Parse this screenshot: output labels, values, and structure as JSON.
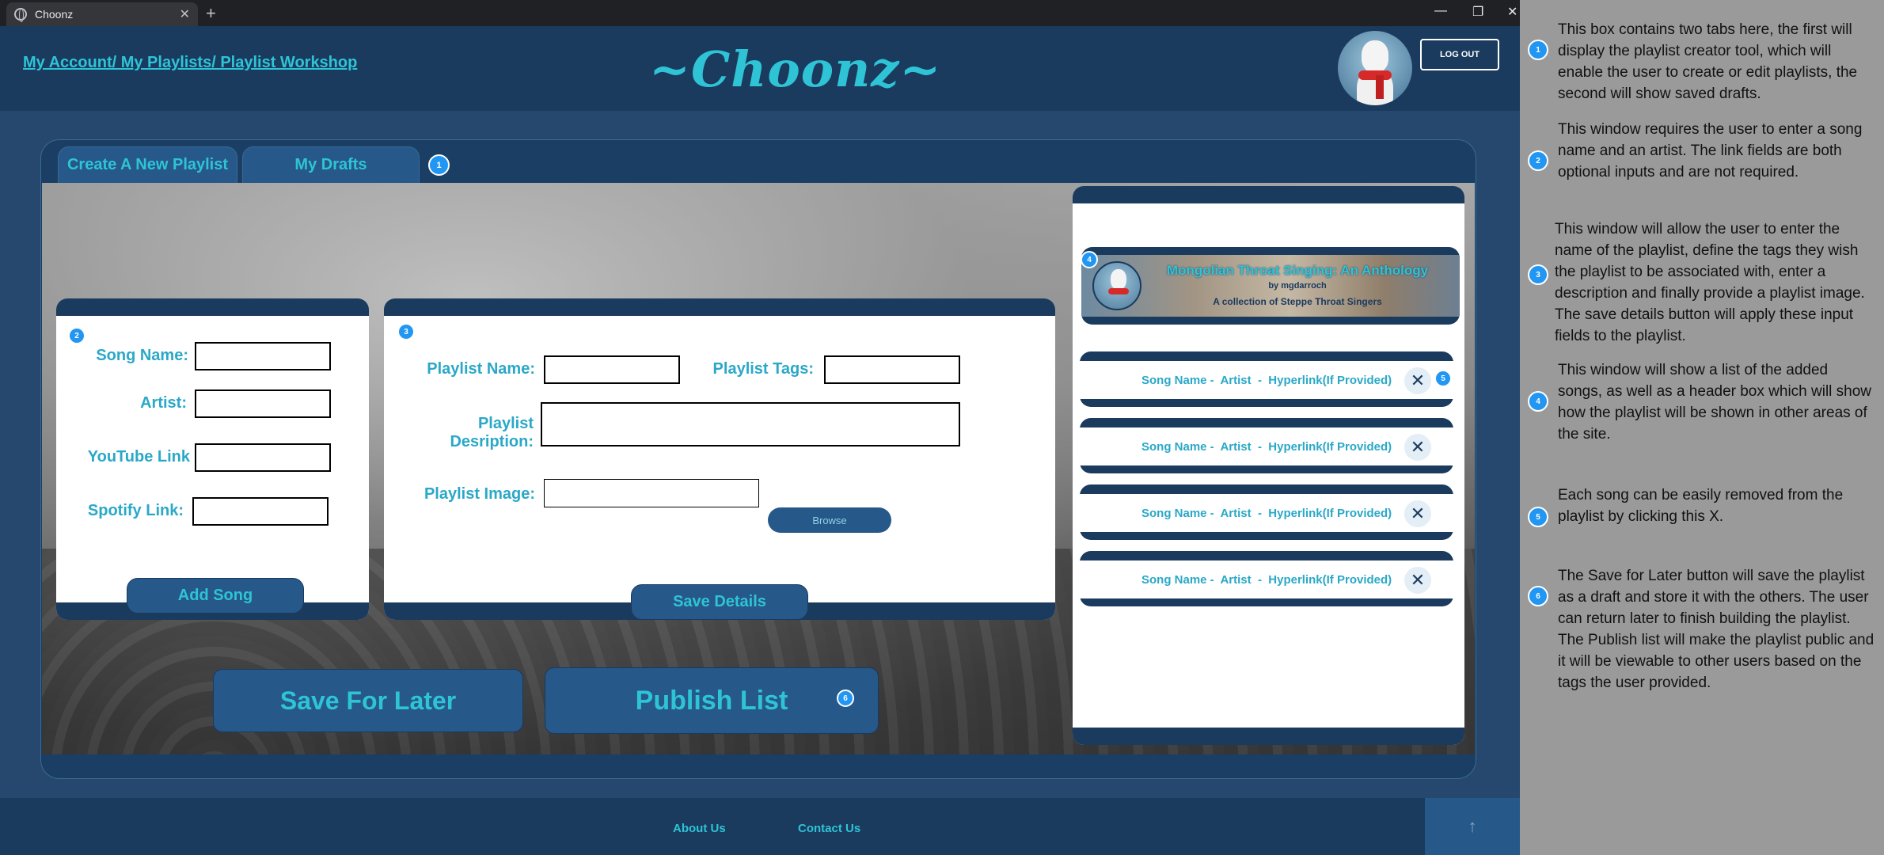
{
  "browser": {
    "tab_title": "Choonz",
    "tab_close": "✕",
    "new_tab": "+",
    "minimize": "—",
    "restore": "❐",
    "close": "✕"
  },
  "header": {
    "breadcrumb": "My Account/ My Playlists/ Playlist Workshop",
    "logo": "~Choonz~",
    "logout_label": "LOG OUT"
  },
  "tabs": [
    {
      "label": "Create A New Playlist"
    },
    {
      "label": "My Drafts"
    }
  ],
  "song_form": {
    "song_name_label": "Song Name:",
    "artist_label": "Artist:",
    "youtube_label": "YouTube Link",
    "spotify_label": "Spotify Link:",
    "song_name_value": "",
    "artist_value": "",
    "youtube_value": "",
    "spotify_value": "",
    "add_song_label": "Add Song"
  },
  "playlist_form": {
    "name_label": "Playlist Name:",
    "tags_label": "Playlist Tags:",
    "description_label": "Playlist Desription:",
    "image_label": "Playlist Image:",
    "name_value": "",
    "tags_value": "",
    "description_value": "",
    "image_value": "",
    "browse_label": "Browse",
    "save_details_label": "Save Details"
  },
  "actions": {
    "save_later_label": "Save For Later",
    "publish_label": "Publish List"
  },
  "preview": {
    "title": "Mongolian Throat Singing: An Anthology",
    "by": "by mgdarroch",
    "description": "A collection of Steppe Throat Singers"
  },
  "songs": [
    {
      "text": "Song Name -  Artist  -  Hyperlink(If Provided)",
      "remove": "✕"
    },
    {
      "text": "Song Name -  Artist  -  Hyperlink(If Provided)",
      "remove": "✕"
    },
    {
      "text": "Song Name -  Artist  -  Hyperlink(If Provided)",
      "remove": "✕"
    },
    {
      "text": "Song Name -  Artist  -  Hyperlink(If Provided)",
      "remove": "✕"
    }
  ],
  "badges": [
    "1",
    "2",
    "3",
    "4",
    "5",
    "6"
  ],
  "footer": {
    "about_label": "About Us",
    "contact_label": "Contact Us",
    "to_top": "↑"
  },
  "notes": [
    {
      "num": "1",
      "text": "This box contains two tabs here, the first will display the playlist creator tool, which will enable the user to create or edit playlists, the second will show saved drafts."
    },
    {
      "num": "2",
      "text": "This window requires the user to enter a song name and an artist.  The link fields are both optional inputs and are not required."
    },
    {
      "num": "3",
      "text": "This window will allow the user to enter the name of the playlist, define the tags they wish the playlist to be associated with, enter a description and finally provide a playlist image.  The save details button will apply these input fields to the playlist."
    },
    {
      "num": "4",
      "text": "This window will show a list of the added songs, as well as a header box which will show how the playlist will be shown in other areas of the site."
    },
    {
      "num": "5",
      "text": "Each song can be easily removed from the playlist by clicking this X."
    },
    {
      "num": "6",
      "text": "The Save for Later button will save the playlist as a draft and store it with the others.  The user can return later to finish building the playlist.  The Publish list will make the playlist public and it will be viewable to other users based on the tags the user provided."
    }
  ],
  "colors": {
    "accent": "#2ec4d6",
    "navy": "#1a3a5e",
    "button": "#26588a",
    "badge": "#2196f3"
  }
}
